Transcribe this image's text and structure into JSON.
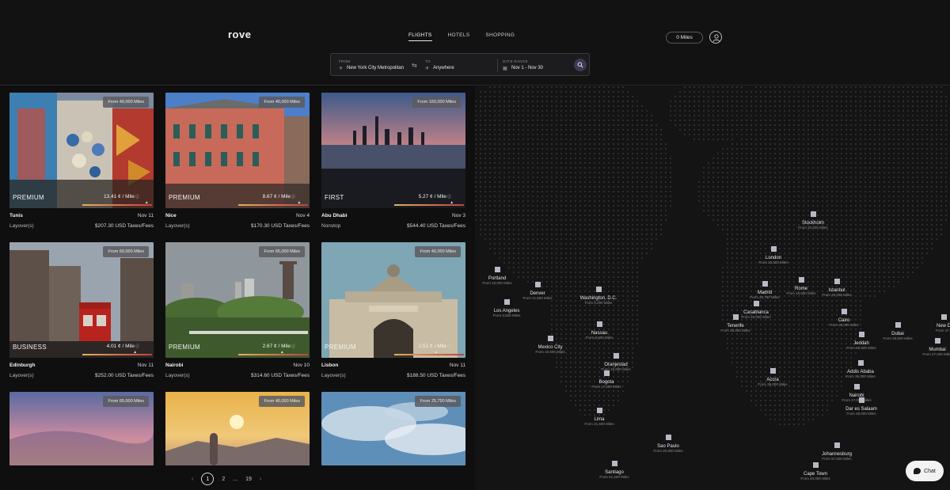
{
  "brand": {
    "logo": "rove"
  },
  "nav": {
    "flights": "FLIGHTS",
    "hotels": "HOTELS",
    "shopping": "SHOPPING"
  },
  "account": {
    "miles": "0 Miles"
  },
  "search": {
    "from_label": "FROM",
    "from_value": "New York City Metropolitan",
    "to_label": "TO",
    "to_value": "Anywhere",
    "date_label": "DATE RANGE",
    "date_value": "Nov 1 - Nov 30"
  },
  "cards": [
    {
      "from": "From 40,000 Miles",
      "tier": "PREMIUM",
      "rate": "13.41 ¢ / Mile",
      "rate_level": 0.95,
      "city": "Tunis",
      "date": "Nov 11",
      "stops": "Layover(s)",
      "price": "$207.30 USD Taxes/Fees"
    },
    {
      "from": "From 40,000 Miles",
      "tier": "PREMIUM",
      "rate": "8.67 ¢ / Mile",
      "rate_level": 0.9,
      "city": "Nice",
      "date": "Nov 4",
      "stops": "Layover(s)",
      "price": "$170.30 USD Taxes/Fees"
    },
    {
      "from": "From 160,000 Miles",
      "tier": "FIRST",
      "rate": "5.27 ¢ / Mile",
      "rate_level": 0.85,
      "city": "Abu Dhabi",
      "date": "Nov 3",
      "stops": "Nonstop",
      "price": "$544.40 USD Taxes/Fees"
    },
    {
      "from": "From 60,000 Miles",
      "tier": "BUSINESS",
      "rate": "4.01 ¢ / Mile",
      "rate_level": 0.78,
      "city": "Edinburgh",
      "date": "Nov 11",
      "stops": "Layover(s)",
      "price": "$252.00 USD Taxes/Fees"
    },
    {
      "from": "From 65,000 Miles",
      "tier": "PREMIUM",
      "rate": "2.67 ¢ / Mile",
      "rate_level": 0.65,
      "city": "Nairobi",
      "date": "Nov 10",
      "stops": "Layover(s)",
      "price": "$314.60 USD Taxes/Fees"
    },
    {
      "from": "From 40,000 Miles",
      "tier": "PREMIUM",
      "rate": "2.51 ¢ / Mile",
      "rate_level": 0.62,
      "city": "Lisbon",
      "date": "Nov 11",
      "stops": "Layover(s)",
      "price": "$188.50 USD Taxes/Fees"
    },
    {
      "from": "From 65,000 Miles"
    },
    {
      "from": "From 40,000 Miles"
    },
    {
      "from": "From 25,750 Miles"
    }
  ],
  "pagination": {
    "prev": "‹",
    "p1": "1",
    "p2": "2",
    "ellipsis": "...",
    "last": "19",
    "next": "›"
  },
  "map": {
    "cities": [
      {
        "name": "Portland",
        "miles": "From 10,000 Miles"
      },
      {
        "name": "Denver",
        "miles": "From 11,500 Miles"
      },
      {
        "name": "Washington, D.C.",
        "miles": "From 5,000 Miles"
      },
      {
        "name": "Los Angeles",
        "miles": "From 5,500 Miles"
      },
      {
        "name": "Nassau",
        "miles": "From 9,000 Miles"
      },
      {
        "name": "Mexico City",
        "miles": "From 10,500 Miles"
      },
      {
        "name": "Oranjestad",
        "miles": "From 10,000 Miles"
      },
      {
        "name": "Bogota",
        "miles": "From 17,000 Miles"
      },
      {
        "name": "Lima",
        "miles": "From 21,500 Miles"
      },
      {
        "name": "Sao Paulo",
        "miles": "From 20,500 Miles"
      },
      {
        "name": "Santiago",
        "miles": "From 61,200 Miles"
      },
      {
        "name": "Stockholm",
        "miles": "From 20,000 Miles"
      },
      {
        "name": "London",
        "miles": "From 23,500 Miles"
      },
      {
        "name": "Madrid",
        "miles": "From 20,750 Miles"
      },
      {
        "name": "Rome",
        "miles": "From 16,500 Miles"
      },
      {
        "name": "Istanbul",
        "miles": "From 25,000 Miles"
      },
      {
        "name": "Casablanca",
        "miles": "From 25,000 Miles"
      },
      {
        "name": "Tenerife",
        "miles": "From 26,000 Miles"
      },
      {
        "name": "Cairo",
        "miles": "From 30,000 Miles"
      },
      {
        "name": "Jeddah",
        "miles": "From 38,500 Miles"
      },
      {
        "name": "Dubai",
        "miles": "From 25,500 Miles"
      },
      {
        "name": "Mumbai",
        "miles": "From 27,000 Miles"
      },
      {
        "name": "New D",
        "miles": "From 47,5"
      },
      {
        "name": "Addis Ababa",
        "miles": "From 36,000 Miles"
      },
      {
        "name": "Accra",
        "miles": "From 35,000 Miles"
      },
      {
        "name": "Nairobi",
        "miles": "From 17,000 Miles"
      },
      {
        "name": "Dar es Salaam",
        "miles": "From 40,000 Miles"
      },
      {
        "name": "Johannesburg",
        "miles": "From 57,500 Miles"
      },
      {
        "name": "Cape Town",
        "miles": "From 40,000 Miles"
      }
    ]
  },
  "chat": {
    "label": "Chat"
  }
}
